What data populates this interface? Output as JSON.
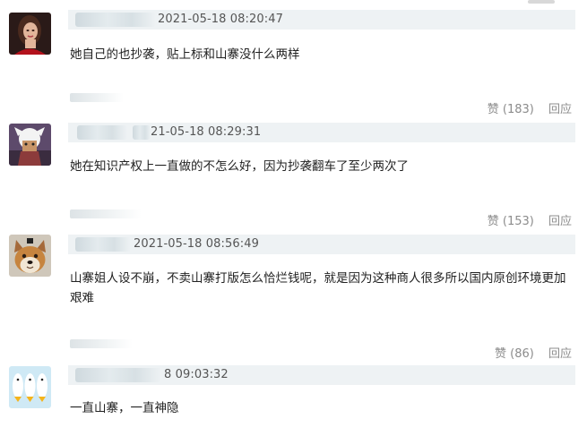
{
  "comments": [
    {
      "timestamp": "2021-05-18 08:20:47",
      "text": "她自己的也抄袭，贴上标和山寨没什么两样",
      "likes_label": "赞 (183)",
      "reply_label": "回应"
    },
    {
      "timestamp": "21-05-18 08:29:31",
      "text": "她在知识产权上一直做的不怎么好，因为抄袭翻车了至少两次了",
      "likes_label": "赞 (153)",
      "reply_label": "回应"
    },
    {
      "timestamp": "2021-05-18 08:56:49",
      "text": "山寨姐人设不崩，不卖山寨打版怎么恰烂钱呢，就是因为这种商人很多所以国内原创环境更加艰难",
      "likes_label": "赞 (86)",
      "reply_label": "回应"
    },
    {
      "timestamp": "8 09:03:32",
      "text": "一直山寨，一直神隐"
    }
  ],
  "avatars": [
    "woman-avatar",
    "anime-character-avatar",
    "shiba-dog-avatar",
    "duck-cartoon-avatar"
  ]
}
